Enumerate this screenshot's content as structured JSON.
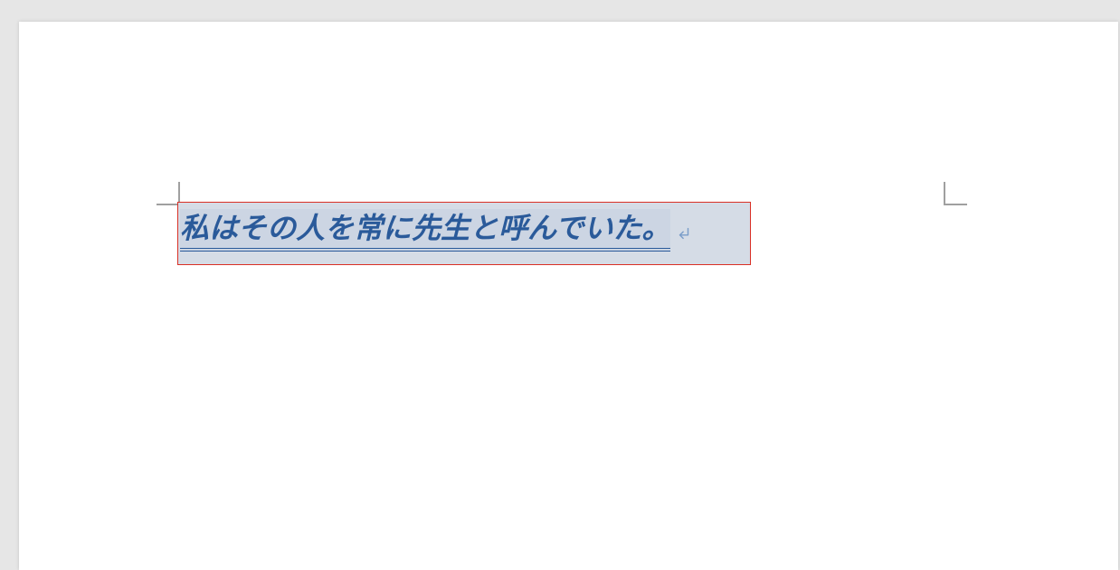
{
  "document": {
    "selected_text": "私はその人を常に先生と呼んでいた。",
    "text_color": "#2a5a9a",
    "highlight_color": "#d5dce6",
    "selection_bg": "#ccd5e3",
    "box_border": "#d93025"
  }
}
